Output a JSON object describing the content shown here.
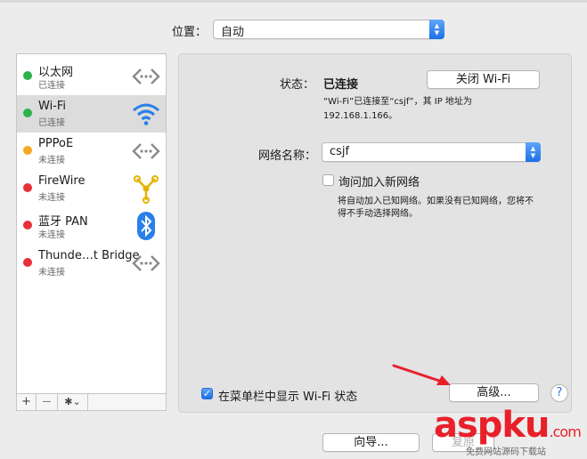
{
  "location": {
    "label": "位置：",
    "value": "自动"
  },
  "services": [
    {
      "name": "以太网",
      "status": "已连接",
      "color": "#2bb34a",
      "icon": "ethernet-arrows-icon",
      "selected": false
    },
    {
      "name": "Wi-Fi",
      "status": "已连接",
      "color": "#2bb34a",
      "icon": "wifi-icon",
      "selected": true
    },
    {
      "name": "PPPoE",
      "status": "未连接",
      "color": "#f5a623",
      "icon": "ethernet-arrows-icon",
      "selected": false
    },
    {
      "name": "FireWire",
      "status": "未连接",
      "color": "#e8303a",
      "icon": "firewire-icon",
      "selected": false
    },
    {
      "name": "蓝牙 PAN",
      "status": "未连接",
      "color": "#e8303a",
      "icon": "bluetooth-icon",
      "selected": false
    },
    {
      "name": "Thunde…t Bridge",
      "status": "未连接",
      "color": "#e8303a",
      "icon": "ethernet-arrows-icon",
      "selected": false
    }
  ],
  "sidebar_buttons": {
    "add": "+",
    "remove": "—",
    "gear": "✱⌄"
  },
  "detail": {
    "status_label": "状态：",
    "status_value": "已连接",
    "toggle_button": "关闭 Wi-Fi",
    "status_desc_line1": "“Wi-Fi”已连接至“csjf”，其 IP 地址为",
    "status_desc_line2": "192.168.1.166。",
    "network_name_label": "网络名称：",
    "network_name_value": "csjf",
    "ask_join_label": "询问加入新网络",
    "ask_join_desc_line1": "将自动加入已知网络。如果没有已知网络，您将不",
    "ask_join_desc_line2": "得不手动选择网络。",
    "show_in_menubar_label": "在菜单栏中显示 Wi-Fi 状态",
    "advanced_button": "高级...",
    "help": "?"
  },
  "footer": {
    "assist_button": "向导...",
    "revert_button": "复原"
  },
  "watermark": {
    "text": "aspku",
    "dotcom": ".com",
    "sub": "免费网站源码下载站"
  },
  "colors": {
    "accent": "#1b6fe8",
    "watermark_red": "#e8202a"
  }
}
